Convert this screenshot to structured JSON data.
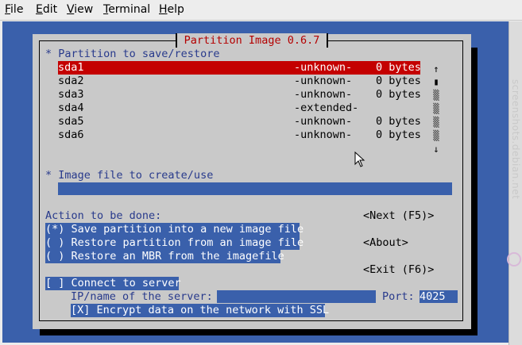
{
  "menubar": {
    "items": [
      {
        "label": "File"
      },
      {
        "label": "Edit"
      },
      {
        "label": "View"
      },
      {
        "label": "Terminal"
      },
      {
        "label": "Help"
      }
    ]
  },
  "dialog": {
    "title": "Partition Image 0.6.7",
    "partition_section_label": "* Partition to save/restore",
    "partitions": [
      {
        "name": "sda1",
        "type": "-unknown-",
        "size": "0 bytes"
      },
      {
        "name": "sda2",
        "type": "-unknown-",
        "size": "0 bytes"
      },
      {
        "name": "sda3",
        "type": "-unknown-",
        "size": "0 bytes"
      },
      {
        "name": "sda4",
        "type": "-extended-",
        "size": ""
      },
      {
        "name": "sda5",
        "type": "-unknown-",
        "size": "0 bytes"
      },
      {
        "name": "sda6",
        "type": "-unknown-",
        "size": "0 bytes"
      }
    ],
    "scroll_up": "↑",
    "scroll_thumb": "▮",
    "scroll_track": "▒",
    "scroll_down": "↓",
    "image_section_label": "* Image file to create/use",
    "image_file_value": "",
    "action_label": "Action to be done:",
    "options": [
      {
        "label": "(*) Save partition into a new image file"
      },
      {
        "label": "( ) Restore partition from an image file"
      },
      {
        "label": "( ) Restore an MBR from the imagefile"
      }
    ],
    "buttons": {
      "next": "<Next (F5)>",
      "about": "<About>",
      "exit": "<Exit (F6)>"
    },
    "connect_label": "[ ] Connect to server",
    "server_label": "IP/name of the server:",
    "server_value": "",
    "port_label": "Port:",
    "port_value": "4025",
    "encrypt_label": "[X] Encrypt data on the network with SSL"
  },
  "watermark": "screenshots.debian.net",
  "colors": {
    "terminal_bg": "#3a60ab",
    "dialog_bg": "#c9c9c9",
    "selection": "#c40000",
    "title": "#b40000",
    "label_blue": "#283a8c"
  }
}
